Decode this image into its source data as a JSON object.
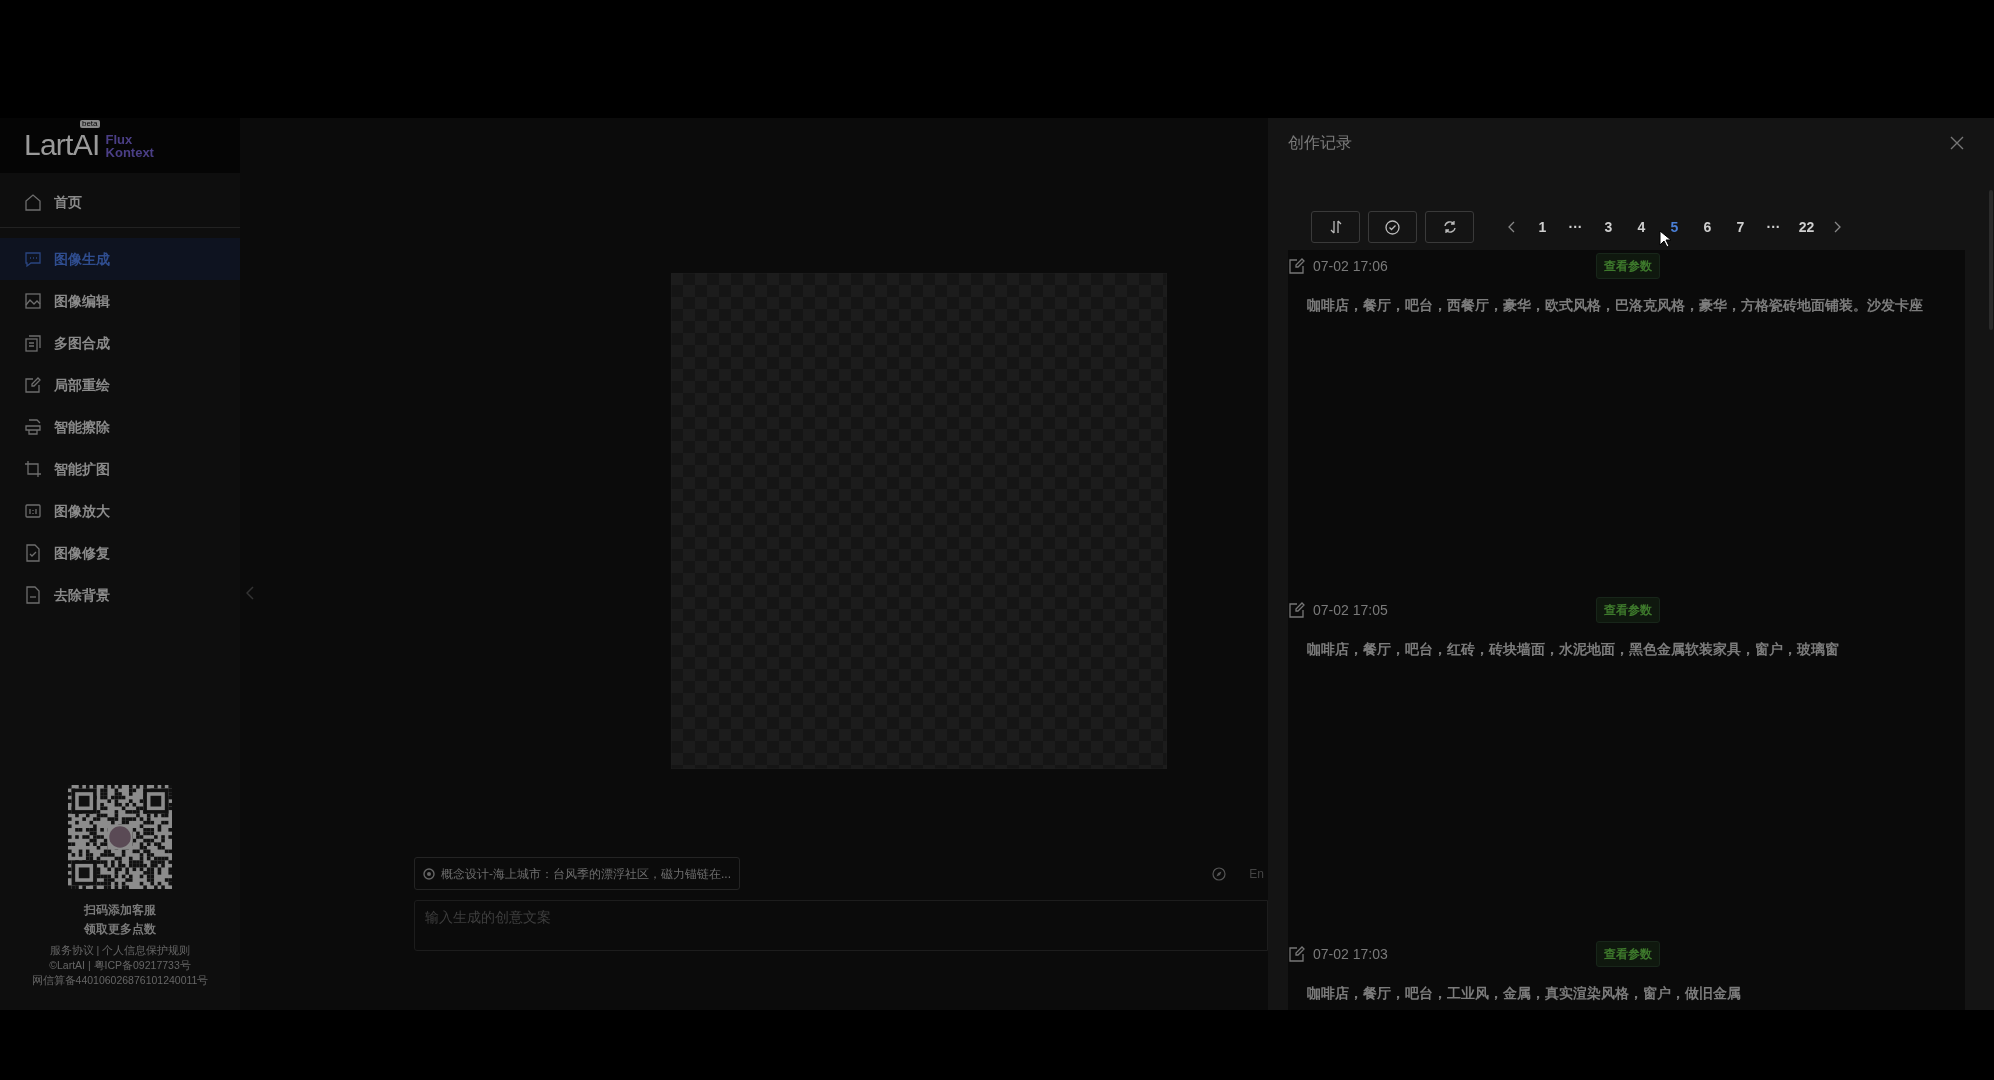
{
  "logo": {
    "name": "LartAI",
    "badge": "beta",
    "line_1": "Flux",
    "line_2": "Kontext"
  },
  "nav": [
    {
      "label": "首页",
      "selected": false
    },
    {
      "label": "图像生成",
      "selected": true
    },
    {
      "label": "图像编辑",
      "selected": false
    },
    {
      "label": "多图合成",
      "selected": false
    },
    {
      "label": "局部重绘",
      "selected": false
    },
    {
      "label": "智能擦除",
      "selected": false
    },
    {
      "label": "智能扩图",
      "selected": false
    },
    {
      "label": "图像放大",
      "selected": false
    },
    {
      "label": "图像修复",
      "selected": false
    },
    {
      "label": "去除背景",
      "selected": false
    }
  ],
  "support": {
    "caption": [
      "扫码添加客服",
      "领取更多点数"
    ],
    "links": "服务协议 | 个人信息保护规则",
    "copyright": "©LartAI | 粤ICP备09217733号",
    "filing": "网信算备440106026876101240011号"
  },
  "composer": {
    "prompt_chip": "概念设计-海上城市：台风季的漂浮社区，磁力锚链在...",
    "language": "En",
    "input": {
      "placeholder": "输入生成的创意文案"
    }
  },
  "history": {
    "title": "创作记录",
    "pages": [
      {
        "label": "1",
        "selected": false
      },
      {
        "label": "···",
        "selected": false
      },
      {
        "label": "3",
        "selected": false
      },
      {
        "label": "4",
        "selected": false
      },
      {
        "label": "5",
        "selected": true
      },
      {
        "label": "6",
        "selected": false
      },
      {
        "label": "7",
        "selected": false
      },
      {
        "label": "···",
        "selected": false
      },
      {
        "label": "22",
        "selected": false
      }
    ],
    "records": [
      {
        "time": "07-02 17:06",
        "action": "查看参数",
        "prompt": "咖啡店，餐厅，吧台，西餐厅，豪华，欧式风格，巴洛克风格，豪华，方格瓷砖地面铺装。沙发卡座"
      },
      {
        "time": "07-02 17:05",
        "action": "查看参数",
        "prompt": "咖啡店，餐厅，吧台，红砖，砖块墙面，水泥地面，黑色金属软装家具，窗户，玻璃窗"
      },
      {
        "time": "07-02 17:03",
        "action": "查看参数",
        "prompt": "咖啡店，餐厅，吧台，工业风，金属，真实渲染风格，窗户，做旧金属"
      }
    ]
  }
}
